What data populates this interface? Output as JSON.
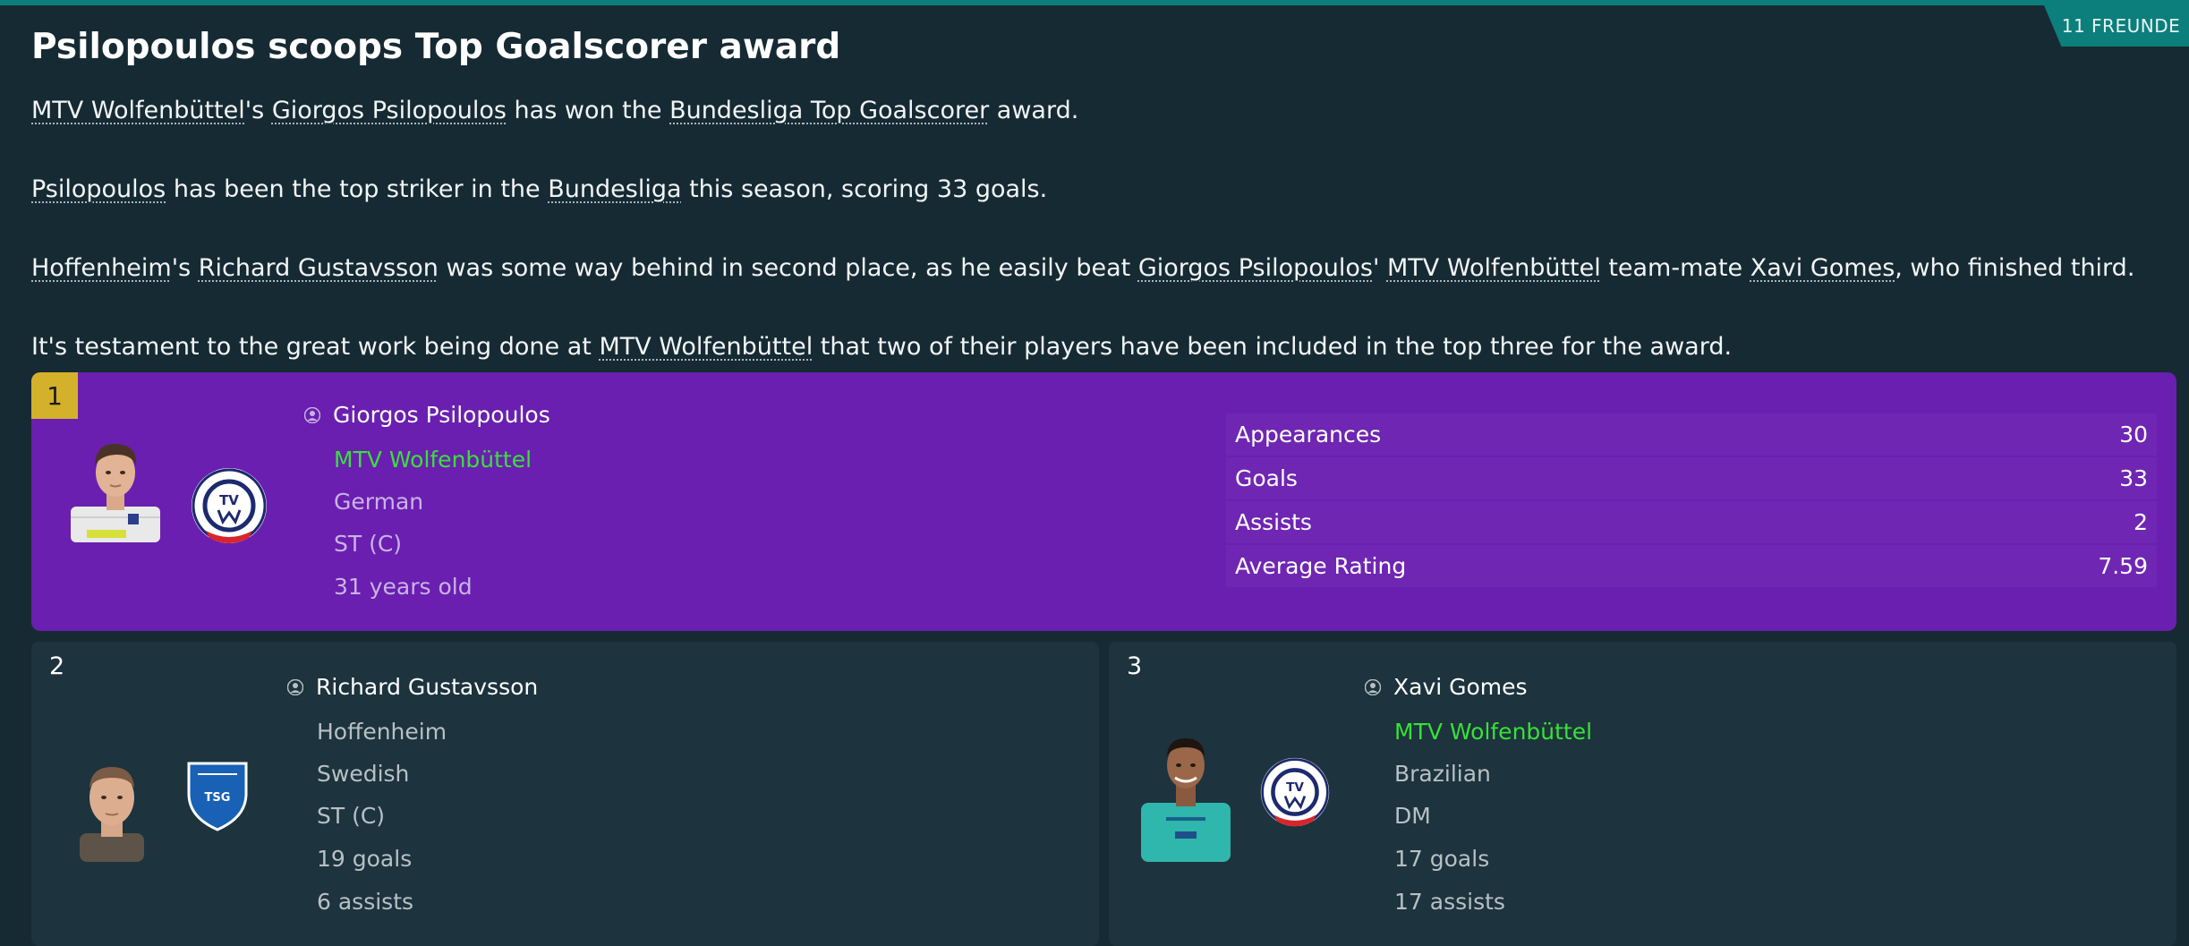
{
  "tag": "11 FREUNDE",
  "headline": "Psilopoulos scoops Top Goalscorer award",
  "paragraphs": {
    "p1": {
      "club": "MTV Wolfenbüttel",
      "s1": "'s ",
      "player": "Giorgos Psilopoulos",
      "s2": " has won the ",
      "league": "Bundesliga",
      "s3": " ",
      "award": "Top Goalscorer",
      "s4": " award."
    },
    "p2": {
      "player": "Psilopoulos",
      "s1": " has been the top striker in the ",
      "league": "Bundesliga",
      "s2": " this season, scoring 33 goals."
    },
    "p3": {
      "club1": "Hoffenheim",
      "s1": "'s ",
      "player1": "Richard Gustavsson",
      "s2": " was some way behind in second place, as he easily beat ",
      "player2": "Giorgos Psilopoulos",
      "s3": "' ",
      "club2": "MTV Wolfenbüttel",
      "s4": " team-mate ",
      "player3": "Xavi Gomes",
      "s5": ", who finished third."
    },
    "p4": {
      "s1": "It's testament to the great work being done at ",
      "club": "MTV Wolfenbüttel",
      "s2": " that two of their players have been included in the top three for the award."
    }
  },
  "winner": {
    "rank": "1",
    "name": "Giorgos Psilopoulos",
    "club": "MTV Wolfenbüttel",
    "nationality": "German",
    "position": "ST (C)",
    "age": "31 years old",
    "stats": [
      {
        "label": "Appearances",
        "value": "30"
      },
      {
        "label": "Goals",
        "value": "33"
      },
      {
        "label": "Assists",
        "value": "2"
      },
      {
        "label": "Average Rating",
        "value": "7.59"
      }
    ],
    "club_badge": {
      "colors": [
        "#ffffff",
        "#1c2a6e",
        "#d6262b"
      ]
    }
  },
  "second": {
    "rank": "2",
    "name": "Richard Gustavsson",
    "club": "Hoffenheim",
    "nationality": "Swedish",
    "position": "ST (C)",
    "goals": "19 goals",
    "assists": "6 assists"
  },
  "third": {
    "rank": "3",
    "name": "Xavi Gomes",
    "club": "MTV Wolfenbüttel",
    "nationality": "Brazilian",
    "position": "DM",
    "goals": "17 goals",
    "assists": "17 assists"
  },
  "colors": {
    "background": "#162a33",
    "accent_teal": "#0c7f7c",
    "winner_panel": "#6a1fb0",
    "gold_rank": "#d4b12a",
    "club_link_green": "#39e03a"
  },
  "icons": [
    "person-icon",
    "club-badge-mtv",
    "club-badge-hoffenheim",
    "player-face"
  ]
}
